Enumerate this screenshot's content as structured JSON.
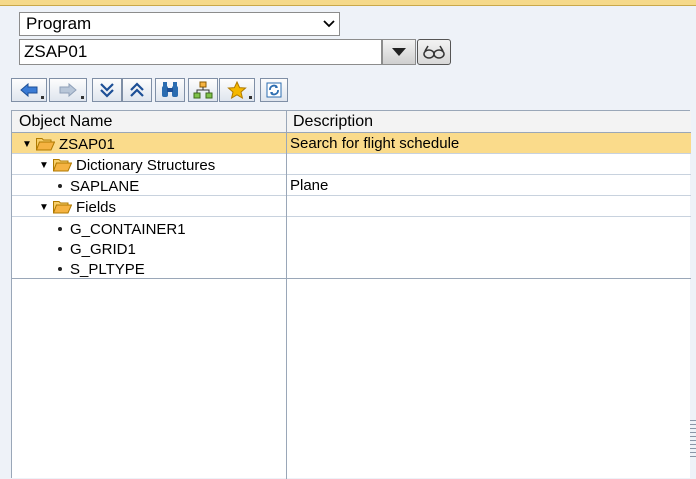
{
  "object_type": {
    "selected": "Program"
  },
  "object_name": {
    "value": "ZSAP01"
  },
  "toolbar": {
    "buttons": [
      {
        "icon": "back-arrow-icon"
      },
      {
        "icon": "forward-arrow-icon"
      },
      {
        "icon": "expand-subtree-icon"
      },
      {
        "icon": "collapse-subtree-icon"
      },
      {
        "icon": "binoculars-icon"
      },
      {
        "icon": "hierarchy-icon"
      },
      {
        "icon": "favorites-star-icon"
      },
      {
        "icon": "refresh-icon"
      }
    ]
  },
  "tree": {
    "columns": {
      "name": "Object Name",
      "description": "Description"
    },
    "rows": [
      {
        "name": "ZSAP01",
        "description": "Search for flight schedule",
        "kind": "folder-expanded",
        "level": 0,
        "selected": true
      },
      {
        "name": "Dictionary Structures",
        "description": "",
        "kind": "folder-expanded",
        "level": 1
      },
      {
        "name": "SAPLANE",
        "description": "Plane",
        "kind": "leaf",
        "level": 2
      },
      {
        "name": "Fields",
        "description": "",
        "kind": "folder-expanded",
        "level": 1
      },
      {
        "name": "G_CONTAINER1",
        "description": "",
        "kind": "leaf",
        "level": 2
      },
      {
        "name": "G_GRID1",
        "description": "",
        "kind": "leaf",
        "level": 2
      },
      {
        "name": "S_PLTYPE",
        "description": "",
        "kind": "leaf",
        "level": 2
      }
    ]
  },
  "colors": {
    "selection": "#fadb8b",
    "folder": "#f5b342",
    "toolbar_icon": "#2b6cb0"
  }
}
